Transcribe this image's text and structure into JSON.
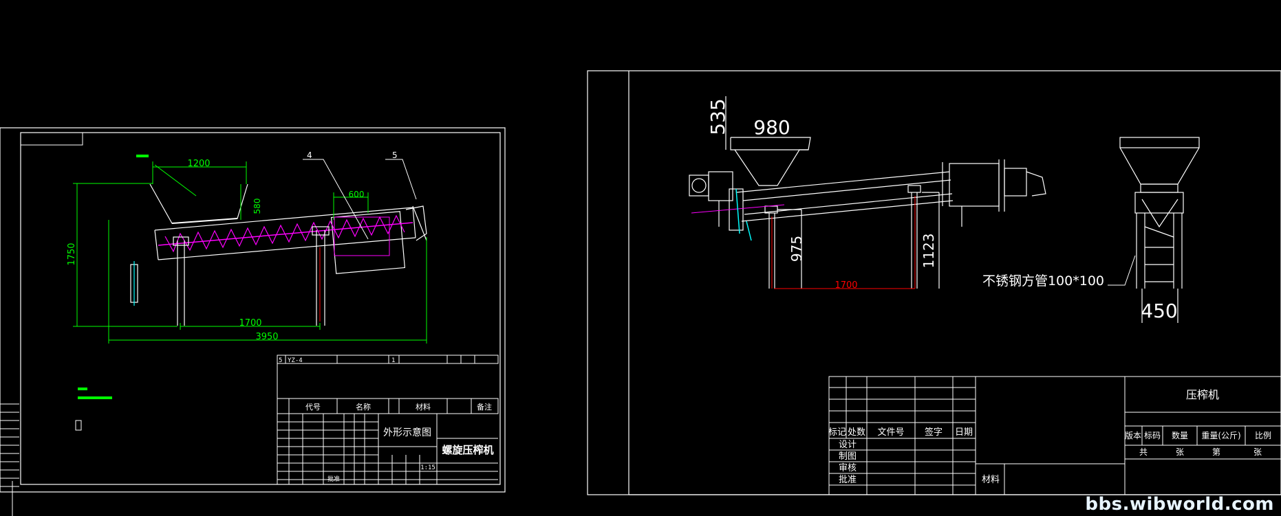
{
  "colors": {
    "background": "#000000",
    "line": "#ffffff",
    "dim": "#00ff00",
    "screw": "#ff00ff",
    "red": "#ff0000",
    "cyan": "#00ffff",
    "yellow": "#ffff00"
  },
  "left_sheet": {
    "dims": {
      "d1200": "1200",
      "d580": "580",
      "d600": "600",
      "d1750": "1750",
      "d1700": "1700",
      "d3950": "3950"
    },
    "callouts": [
      "4",
      "5"
    ],
    "parts_row": [
      "5",
      "YZ-4",
      "",
      "1"
    ],
    "header": {
      "code": "代号",
      "name": "名称",
      "material": "材料",
      "remark": "备注"
    },
    "drawing_title": "外形示意图",
    "machine_name": "螺旋压榨机",
    "scale": "1:15",
    "approve": "批准"
  },
  "right_sheet": {
    "dims": {
      "d535": "535",
      "d980": "980",
      "d975": "975",
      "d1123": "1123",
      "d1700": "1700",
      "d450": "450"
    },
    "note": "不锈钢方管100*100",
    "title_block": {
      "product": "压榨机",
      "cols": [
        "标记",
        "处数",
        "文件号",
        "签字",
        "日期"
      ],
      "rows": [
        "设计",
        "制图",
        "审核",
        "批准"
      ],
      "material": "材料",
      "right_header": [
        "版本",
        "标码",
        "数量",
        "重量(公斤)",
        "比例"
      ],
      "right_row": [
        "共",
        "张",
        "第",
        "张"
      ]
    }
  },
  "watermark": "bbs.wibworld.com"
}
